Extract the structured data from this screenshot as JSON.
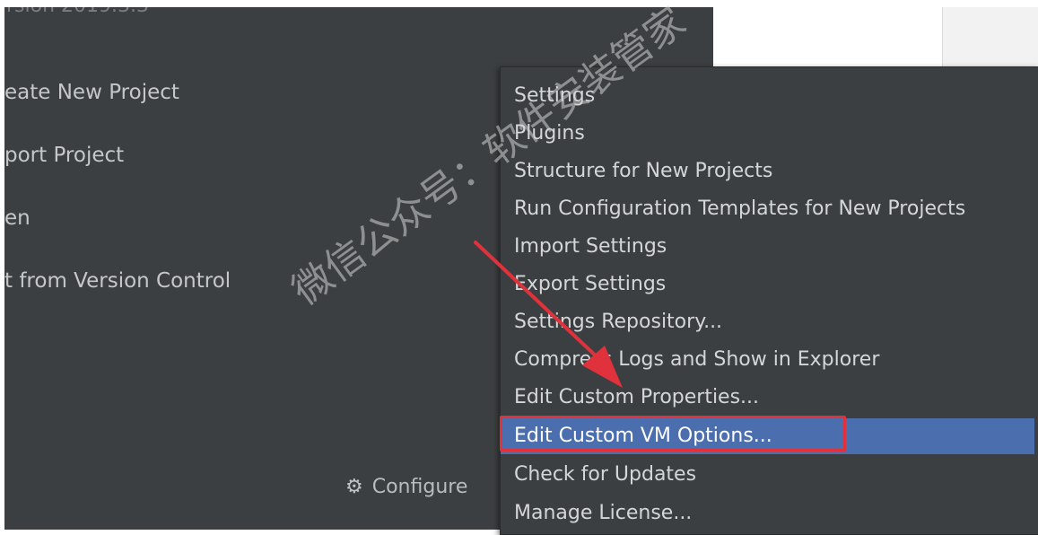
{
  "header": {
    "version_text": "rsion 2019.3.3"
  },
  "welcome_actions": [
    {
      "label": "eate New Project"
    },
    {
      "label": "port Project"
    },
    {
      "label": "en"
    },
    {
      "label": "t from Version Control"
    }
  ],
  "configure": {
    "label": "Configure",
    "icon": "gear-icon"
  },
  "configure_menu": {
    "items": [
      {
        "label": "Settings"
      },
      {
        "label": "Plugins"
      },
      {
        "label": "Structure for New Projects"
      },
      {
        "label": "Run Configuration Templates for New Projects"
      },
      {
        "label": "Import Settings"
      },
      {
        "label": "Export Settings"
      },
      {
        "label": "Settings Repository..."
      },
      {
        "label": "Compress Logs and Show in Explorer"
      },
      {
        "label": "Edit Custom Properties..."
      },
      {
        "label": "Edit Custom VM Options..."
      },
      {
        "label": "Check for Updates"
      },
      {
        "label": "Manage License..."
      }
    ],
    "selected_item": "Edit Custom VM Options..."
  },
  "annotations": {
    "watermark": "微信公众号：软件安装管家",
    "arrow_color": "#e0323c",
    "highlight_color": "#e0323c"
  },
  "colors": {
    "window_bg": "#3c3f41",
    "menu_selected_bg": "#4b6eaf",
    "menu_text": "#d4d6d8"
  }
}
